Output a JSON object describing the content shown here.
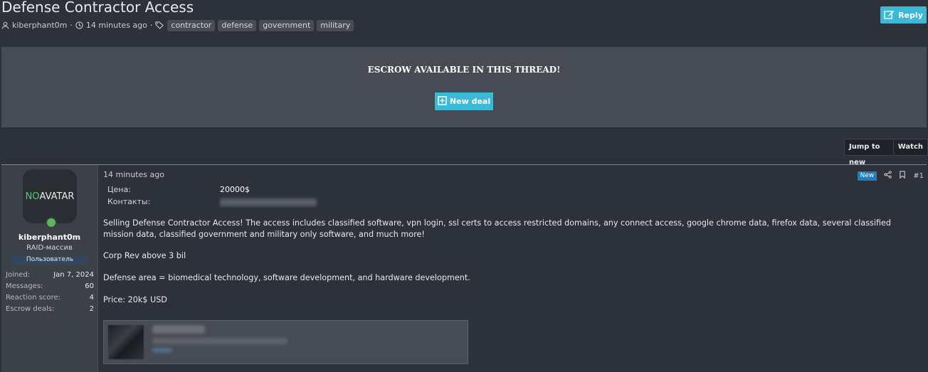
{
  "thread": {
    "title": "Defense Contractor Access",
    "author": "kiberphant0m",
    "time": "14 minutes ago",
    "tags": [
      "contractor",
      "defense",
      "government",
      "military"
    ]
  },
  "actions": {
    "reply": "Reply",
    "jump_to_new": "Jump to new",
    "watch": "Watch"
  },
  "escrow": {
    "title": "ESCROW AVAILABLE IN THIS THREAD!",
    "new_deal": "New deal"
  },
  "post": {
    "time": "14 minutes ago",
    "new_badge": "New",
    "number": "#1",
    "price_label": "Цена:",
    "price_value": "20000$",
    "contacts_label": "Контакты:",
    "paragraphs": [
      "Selling Defense Contractor Access! The access includes classified software, vpn login, ssl certs to access restricted domains, any connect access, google chrome data, firefox data, several classified mission data, classified government and military only software, and much more!",
      "Corp Rev above 3 bil",
      "Defense area = biomedical technology, software development, and hardware development.",
      "Price: 20k$ USD"
    ]
  },
  "user": {
    "avatar_no": "NO",
    "avatar_text": "AVATAR",
    "name": "kiberphant0m",
    "title": "RAID-массив",
    "badge": "Пользователь",
    "stats": [
      {
        "label": "Joined:",
        "value": "Jan 7, 2024"
      },
      {
        "label": "Messages:",
        "value": "60"
      },
      {
        "label": "Reaction score:",
        "value": "4"
      },
      {
        "label": "Escrow deals:",
        "value": "2"
      }
    ]
  },
  "colors": {
    "accent": "#3bb9d6",
    "new_badge": "#1d7fc1",
    "online": "#5cb85c"
  }
}
